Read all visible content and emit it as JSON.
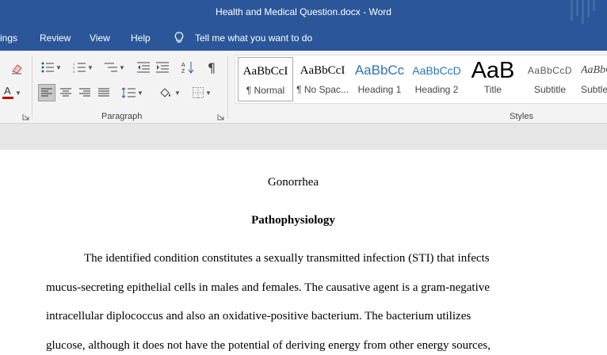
{
  "window": {
    "doc_name": "Health and Medical Question.docx",
    "separator": "-",
    "app_name": "Word"
  },
  "menu": {
    "tabs": [
      "ings",
      "Review",
      "View",
      "Help"
    ],
    "tell_me": "Tell me what you want to do"
  },
  "ribbon": {
    "paragraph_label": "Paragraph",
    "styles_label": "Styles",
    "styles": [
      {
        "sample": "AaBbCcI",
        "name": "¶ Normal",
        "color": "#000000"
      },
      {
        "sample": "AaBbCcI",
        "name": "¶ No Spac...",
        "color": "#000000"
      },
      {
        "sample": "AaBbCc",
        "name": "Heading 1",
        "color": "#2e74b5"
      },
      {
        "sample": "AaBbCcD",
        "name": "Heading 2",
        "color": "#2e74b5"
      },
      {
        "sample": "AaB",
        "name": "Title",
        "color": "#000000"
      },
      {
        "sample": "AaBbCcD",
        "name": "Subtitle",
        "color": "#595959"
      },
      {
        "sample": "AaBbC",
        "name": "Subtle",
        "color": "#404040"
      }
    ]
  },
  "document": {
    "title": "Gonorrhea",
    "heading": "Pathophysiology",
    "lines": [
      "The identified condition constitutes a sexually transmitted infection (STI) that infects",
      "mucus-secreting epithelial cells in males and females. The causative agent is a gram-negative",
      "intracellular diplococcus and also an oxidative-positive bacterium. The bacterium utilizes",
      "glucose, although it does not have the potential of deriving energy from other energy sources,"
    ]
  },
  "colors": {
    "titlebar": "#2b579a",
    "font_color_swatch": "#c00000",
    "heading_style": "#2e74b5"
  }
}
